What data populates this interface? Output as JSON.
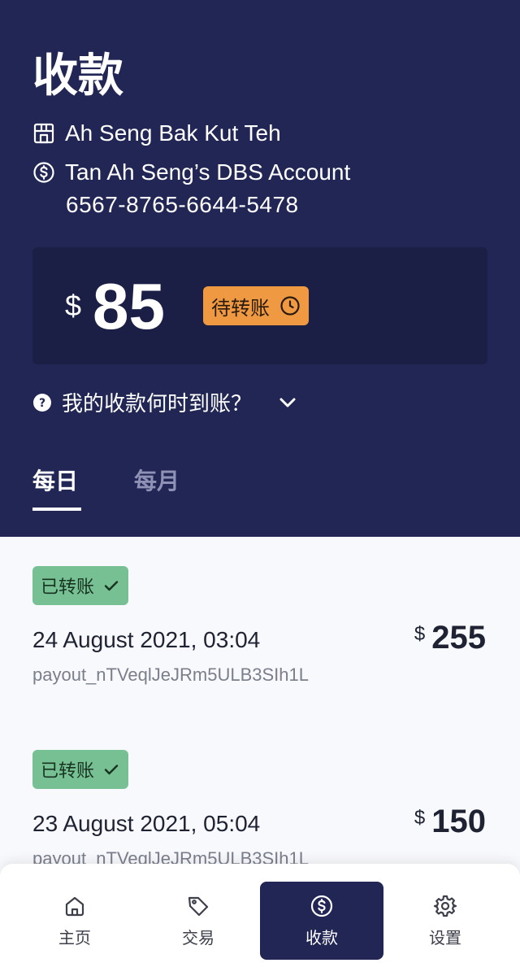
{
  "header": {
    "title": "收款",
    "shop_name": "Ah Seng Bak Kut Teh",
    "account_name": "Tan Ah Seng’s DBS Account",
    "account_number": "6567-8765-6644-5478"
  },
  "balance": {
    "currency": "$",
    "amount": "85",
    "status": "待转账"
  },
  "faq": {
    "label": "我的收款何时到账？"
  },
  "tabs": [
    {
      "label": "每日",
      "active": true
    },
    {
      "label": "每月",
      "active": false
    }
  ],
  "payouts": [
    {
      "status": "已转账",
      "date": "24 August 2021, 03:04",
      "id": "payout_nTVeqlJeJRm5ULB3SIh1L",
      "currency": "$",
      "amount": "255"
    },
    {
      "status": "已转账",
      "date": "23 August 2021, 05:04",
      "id": "payout_nTVeqlJeJRm5ULB3SIh1L",
      "currency": "$",
      "amount": "150"
    }
  ],
  "nav": {
    "items": [
      {
        "label": "主页",
        "icon": "home-icon"
      },
      {
        "label": "交易",
        "icon": "tag-icon"
      },
      {
        "label": "收款",
        "icon": "dollar-circle-icon",
        "active": true
      },
      {
        "label": "设置",
        "icon": "gear-icon"
      }
    ]
  },
  "colors": {
    "header_bg": "#222655",
    "card_bg": "#1b1e45",
    "pending": "#ef9a43",
    "success": "#77c094"
  }
}
